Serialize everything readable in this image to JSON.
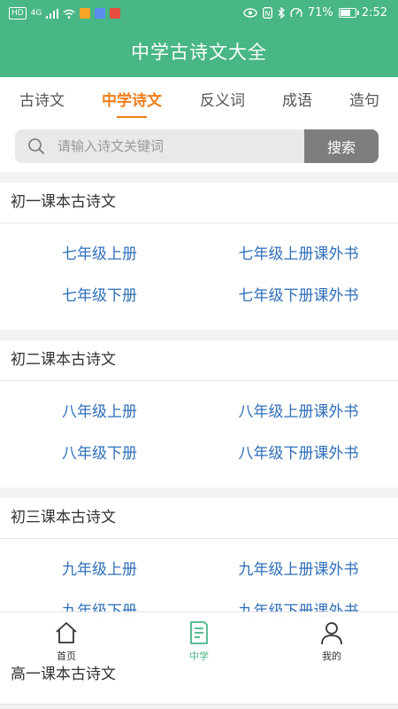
{
  "status_bar": {
    "hd": "HD",
    "network": "4G",
    "battery_text": "71%",
    "battery_level": 0.71,
    "time": "2:52"
  },
  "app": {
    "title": "中学古诗文大全",
    "accent": "#48b685",
    "tab_accent": "#f07d1a",
    "link_color": "#2f6fba"
  },
  "tabs": [
    {
      "label": "古诗文",
      "active": false
    },
    {
      "label": "中学诗文",
      "active": true
    },
    {
      "label": "反义词",
      "active": false
    },
    {
      "label": "成语",
      "active": false
    },
    {
      "label": "造句",
      "active": false
    }
  ],
  "search": {
    "placeholder": "请输入诗文关键词",
    "value": "",
    "button_label": "搜索"
  },
  "sections": [
    {
      "title": "初一课本古诗文",
      "items": [
        "七年级上册",
        "七年级上册课外书",
        "七年级下册",
        "七年级下册课外书"
      ]
    },
    {
      "title": "初二课本古诗文",
      "items": [
        "八年级上册",
        "八年级上册课外书",
        "八年级下册",
        "八年级下册课外书"
      ]
    },
    {
      "title": "初三课本古诗文",
      "items": [
        "九年级上册",
        "九年级上册课外书",
        "九年级下册",
        "九年级下册课外书"
      ]
    },
    {
      "title": "高一课本古诗文"
    }
  ],
  "bottom_nav": [
    {
      "label": "首页",
      "icon": "home-icon",
      "active": false
    },
    {
      "label": "中学",
      "icon": "document-icon",
      "active": true
    },
    {
      "label": "我的",
      "icon": "user-icon",
      "active": false
    }
  ]
}
